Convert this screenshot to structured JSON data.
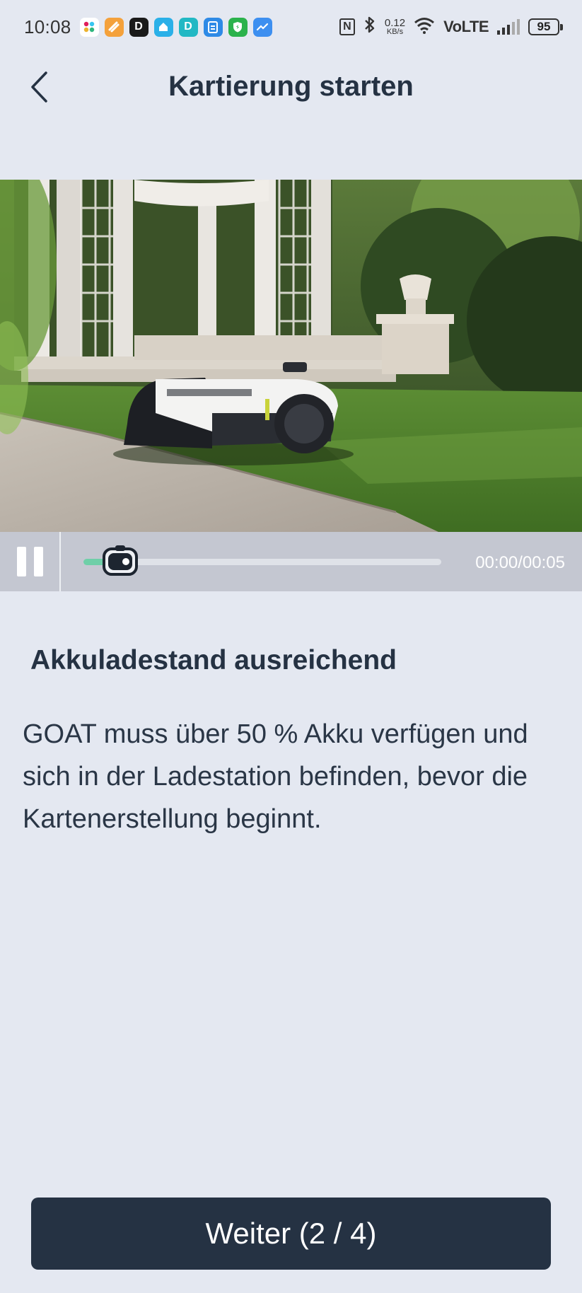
{
  "status_bar": {
    "time": "10:08",
    "app_icons": [
      {
        "name": "slack-icon",
        "color": "#ffffff",
        "glyph": "✲"
      },
      {
        "name": "tasks-app-icon",
        "color": "#f4a13b",
        "glyph": "⌇"
      },
      {
        "name": "d-app-icon",
        "color": "#1a1a1a",
        "glyph": "D"
      },
      {
        "name": "home-app-icon",
        "color": "#2ab0e8",
        "glyph": "⌂"
      },
      {
        "name": "d-teal-app-icon",
        "color": "#22b8c4",
        "glyph": "D"
      },
      {
        "name": "clipboard-app-icon",
        "color": "#2e8ae6",
        "glyph": "▤"
      },
      {
        "name": "shield-app-icon",
        "color": "#2bb24c",
        "glyph": "⛨"
      },
      {
        "name": "trend-app-icon",
        "color": "#3d8ff0",
        "glyph": "↗"
      }
    ],
    "nfc_label": "N",
    "net_speed_value": "0.12",
    "net_speed_unit": "KB/s",
    "network_label": "VoLTE",
    "battery_level": "95"
  },
  "header": {
    "title": "Kartierung starten"
  },
  "video": {
    "time_readout": "00:00/00:05",
    "progress": 0.08,
    "accent_color": "#6fcfa8"
  },
  "content": {
    "heading": "Akkuladestand ausreichend",
    "body": "GOAT muss über 50 % Akku verfügen und sich in der Ladestation befinden, bevor die Kartenerstellung beginnt."
  },
  "footer": {
    "next_label": "Weiter (2 / 4)"
  }
}
